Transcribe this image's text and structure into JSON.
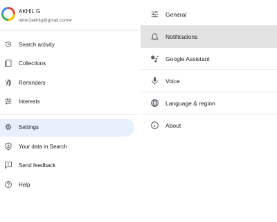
{
  "account": {
    "name": "AKHIL G",
    "email": "letter2akhilg@gmail.com"
  },
  "menu": [
    {
      "label": "Search activity",
      "icon": "history-icon"
    },
    {
      "label": "Collections",
      "icon": "collections-icon"
    },
    {
      "label": "Reminders",
      "icon": "reminders-icon"
    },
    {
      "label": "Interests",
      "icon": "interests-icon"
    },
    {
      "label": "Settings",
      "icon": "gear-icon"
    },
    {
      "label": "Your data in Search",
      "icon": "shield-icon"
    },
    {
      "label": "Send feedback",
      "icon": "feedback-icon"
    },
    {
      "label": "Help",
      "icon": "help-icon"
    }
  ],
  "settings": [
    {
      "label": "General",
      "icon": "sliders-icon"
    },
    {
      "label": "Notifications",
      "icon": "bell-icon"
    },
    {
      "label": "Google Assistant",
      "icon": "assistant-icon"
    },
    {
      "label": "Voice",
      "icon": "microphone-icon"
    },
    {
      "label": "Language & region",
      "icon": "globe-icon"
    },
    {
      "label": "About",
      "icon": "info-icon"
    }
  ],
  "colors": {
    "active_bg": "#e8f0fe",
    "highlight_bg": "#e3e3e3",
    "icon": "#5f6368",
    "text": "#202124"
  }
}
